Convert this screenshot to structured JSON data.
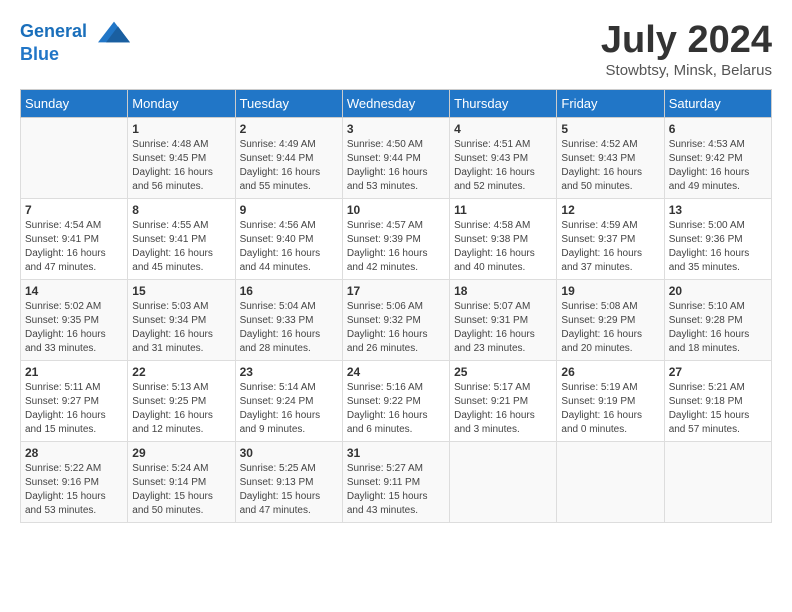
{
  "header": {
    "logo_line1": "General",
    "logo_line2": "Blue",
    "month_year": "July 2024",
    "location": "Stowbtsy, Minsk, Belarus"
  },
  "days_of_week": [
    "Sunday",
    "Monday",
    "Tuesday",
    "Wednesday",
    "Thursday",
    "Friday",
    "Saturday"
  ],
  "weeks": [
    [
      {
        "day": "",
        "info": ""
      },
      {
        "day": "1",
        "info": "Sunrise: 4:48 AM\nSunset: 9:45 PM\nDaylight: 16 hours\nand 56 minutes."
      },
      {
        "day": "2",
        "info": "Sunrise: 4:49 AM\nSunset: 9:44 PM\nDaylight: 16 hours\nand 55 minutes."
      },
      {
        "day": "3",
        "info": "Sunrise: 4:50 AM\nSunset: 9:44 PM\nDaylight: 16 hours\nand 53 minutes."
      },
      {
        "day": "4",
        "info": "Sunrise: 4:51 AM\nSunset: 9:43 PM\nDaylight: 16 hours\nand 52 minutes."
      },
      {
        "day": "5",
        "info": "Sunrise: 4:52 AM\nSunset: 9:43 PM\nDaylight: 16 hours\nand 50 minutes."
      },
      {
        "day": "6",
        "info": "Sunrise: 4:53 AM\nSunset: 9:42 PM\nDaylight: 16 hours\nand 49 minutes."
      }
    ],
    [
      {
        "day": "7",
        "info": "Sunrise: 4:54 AM\nSunset: 9:41 PM\nDaylight: 16 hours\nand 47 minutes."
      },
      {
        "day": "8",
        "info": "Sunrise: 4:55 AM\nSunset: 9:41 PM\nDaylight: 16 hours\nand 45 minutes."
      },
      {
        "day": "9",
        "info": "Sunrise: 4:56 AM\nSunset: 9:40 PM\nDaylight: 16 hours\nand 44 minutes."
      },
      {
        "day": "10",
        "info": "Sunrise: 4:57 AM\nSunset: 9:39 PM\nDaylight: 16 hours\nand 42 minutes."
      },
      {
        "day": "11",
        "info": "Sunrise: 4:58 AM\nSunset: 9:38 PM\nDaylight: 16 hours\nand 40 minutes."
      },
      {
        "day": "12",
        "info": "Sunrise: 4:59 AM\nSunset: 9:37 PM\nDaylight: 16 hours\nand 37 minutes."
      },
      {
        "day": "13",
        "info": "Sunrise: 5:00 AM\nSunset: 9:36 PM\nDaylight: 16 hours\nand 35 minutes."
      }
    ],
    [
      {
        "day": "14",
        "info": "Sunrise: 5:02 AM\nSunset: 9:35 PM\nDaylight: 16 hours\nand 33 minutes."
      },
      {
        "day": "15",
        "info": "Sunrise: 5:03 AM\nSunset: 9:34 PM\nDaylight: 16 hours\nand 31 minutes."
      },
      {
        "day": "16",
        "info": "Sunrise: 5:04 AM\nSunset: 9:33 PM\nDaylight: 16 hours\nand 28 minutes."
      },
      {
        "day": "17",
        "info": "Sunrise: 5:06 AM\nSunset: 9:32 PM\nDaylight: 16 hours\nand 26 minutes."
      },
      {
        "day": "18",
        "info": "Sunrise: 5:07 AM\nSunset: 9:31 PM\nDaylight: 16 hours\nand 23 minutes."
      },
      {
        "day": "19",
        "info": "Sunrise: 5:08 AM\nSunset: 9:29 PM\nDaylight: 16 hours\nand 20 minutes."
      },
      {
        "day": "20",
        "info": "Sunrise: 5:10 AM\nSunset: 9:28 PM\nDaylight: 16 hours\nand 18 minutes."
      }
    ],
    [
      {
        "day": "21",
        "info": "Sunrise: 5:11 AM\nSunset: 9:27 PM\nDaylight: 16 hours\nand 15 minutes."
      },
      {
        "day": "22",
        "info": "Sunrise: 5:13 AM\nSunset: 9:25 PM\nDaylight: 16 hours\nand 12 minutes."
      },
      {
        "day": "23",
        "info": "Sunrise: 5:14 AM\nSunset: 9:24 PM\nDaylight: 16 hours\nand 9 minutes."
      },
      {
        "day": "24",
        "info": "Sunrise: 5:16 AM\nSunset: 9:22 PM\nDaylight: 16 hours\nand 6 minutes."
      },
      {
        "day": "25",
        "info": "Sunrise: 5:17 AM\nSunset: 9:21 PM\nDaylight: 16 hours\nand 3 minutes."
      },
      {
        "day": "26",
        "info": "Sunrise: 5:19 AM\nSunset: 9:19 PM\nDaylight: 16 hours\nand 0 minutes."
      },
      {
        "day": "27",
        "info": "Sunrise: 5:21 AM\nSunset: 9:18 PM\nDaylight: 15 hours\nand 57 minutes."
      }
    ],
    [
      {
        "day": "28",
        "info": "Sunrise: 5:22 AM\nSunset: 9:16 PM\nDaylight: 15 hours\nand 53 minutes."
      },
      {
        "day": "29",
        "info": "Sunrise: 5:24 AM\nSunset: 9:14 PM\nDaylight: 15 hours\nand 50 minutes."
      },
      {
        "day": "30",
        "info": "Sunrise: 5:25 AM\nSunset: 9:13 PM\nDaylight: 15 hours\nand 47 minutes."
      },
      {
        "day": "31",
        "info": "Sunrise: 5:27 AM\nSunset: 9:11 PM\nDaylight: 15 hours\nand 43 minutes."
      },
      {
        "day": "",
        "info": ""
      },
      {
        "day": "",
        "info": ""
      },
      {
        "day": "",
        "info": ""
      }
    ]
  ]
}
